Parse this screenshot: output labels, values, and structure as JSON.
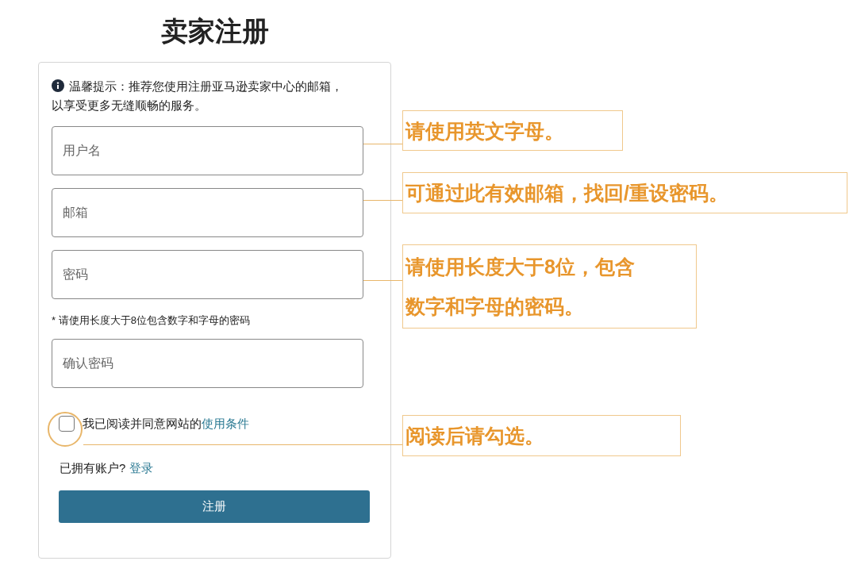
{
  "title": "卖家注册",
  "notice": [
    "温馨提示：推荐您使用注册亚马逊卖家中心的邮箱，",
    "以享受更多无缝顺畅的服务。"
  ],
  "fields": [
    {
      "placeholder": "用户名"
    },
    {
      "placeholder": "邮箱"
    },
    {
      "placeholder": "密码"
    },
    {
      "placeholder": "确认密码"
    }
  ],
  "password_hint": "* 请使用长度大于8位包含数字和字母的密码",
  "agree": {
    "text": "我已阅读并同意网站的",
    "link": "使用条件",
    "checked": false
  },
  "login": {
    "text": "已拥有账户?",
    "link": "登录"
  },
  "submit": "注册",
  "annotations": [
    {
      "lines": [
        "请使用英文字母。"
      ]
    },
    {
      "lines": [
        "可通过此有效邮箱，找回/重设密码。"
      ]
    },
    {
      "lines": [
        "请使用长度大于8位，包含",
        "数字和字母的密码。"
      ]
    },
    {
      "lines": [
        "阅读后请勾选。"
      ]
    }
  ]
}
